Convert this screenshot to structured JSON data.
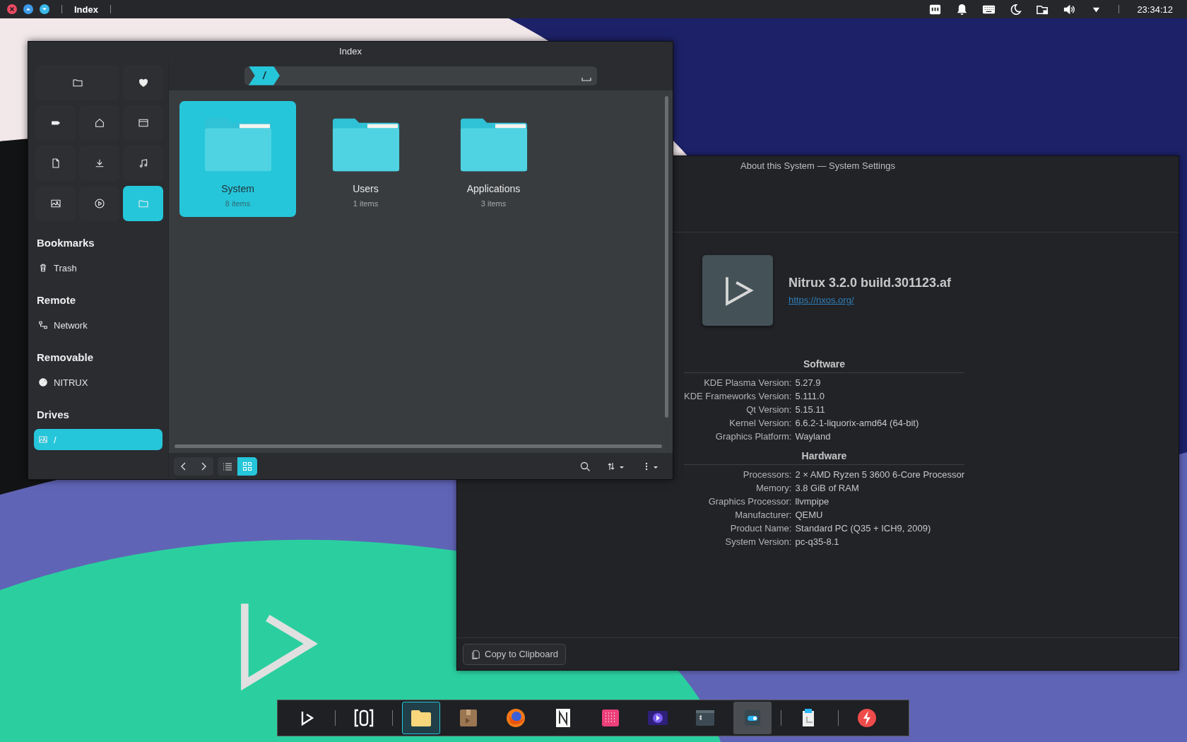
{
  "top_bar": {
    "window_title": "Index",
    "clock": "23:34:12"
  },
  "file_manager": {
    "title": "Index",
    "path": "/",
    "places": [
      {
        "selected": false
      },
      {
        "selected": false
      },
      {
        "selected": false
      },
      {
        "selected": false
      },
      {
        "selected": false
      },
      {
        "selected": false
      },
      {
        "selected": false
      },
      {
        "selected": false
      },
      {
        "selected": false
      },
      {
        "selected": false
      },
      {
        "selected": true
      }
    ],
    "sections": [
      {
        "title": "Bookmarks",
        "items": [
          {
            "label": "Trash",
            "selected": false
          }
        ]
      },
      {
        "title": "Remote",
        "items": [
          {
            "label": "Network",
            "selected": false
          }
        ]
      },
      {
        "title": "Removable",
        "items": [
          {
            "label": "NITRUX",
            "selected": false
          }
        ]
      },
      {
        "title": "Drives",
        "items": [
          {
            "label": "/",
            "selected": true
          }
        ]
      }
    ],
    "folders": [
      {
        "name": "System",
        "count": "8 items",
        "selected": true
      },
      {
        "name": "Users",
        "count": "1 items",
        "selected": false
      },
      {
        "name": "Applications",
        "count": "3 items",
        "selected": false
      }
    ],
    "view_buttons": [
      {
        "selected": false
      },
      {
        "selected": true
      }
    ]
  },
  "settings": {
    "title": "About this System — System Settings",
    "distro": "Nitrux 3.2.0 build.301123.af",
    "url": "https://nxos.org/",
    "sections": [
      {
        "title": "Software",
        "rows": [
          {
            "label": "KDE Plasma Version:",
            "value": "5.27.9"
          },
          {
            "label": "KDE Frameworks Version:",
            "value": "5.111.0"
          },
          {
            "label": "Qt Version:",
            "value": "5.15.11"
          },
          {
            "label": "Kernel Version:",
            "value": "6.6.2-1-liquorix-amd64 (64-bit)"
          },
          {
            "label": "Graphics Platform:",
            "value": "Wayland"
          }
        ]
      },
      {
        "title": "Hardware",
        "rows": [
          {
            "label": "Processors:",
            "value": "2 × AMD Ryzen 5 3600 6-Core Processor"
          },
          {
            "label": "Memory:",
            "value": "3.8 GiB of RAM"
          },
          {
            "label": "Graphics Processor:",
            "value": "llvmpipe"
          },
          {
            "label": "Manufacturer:",
            "value": "QEMU"
          },
          {
            "label": "Product Name:",
            "value": "Standard PC (Q35 + ICH9, 2009)"
          },
          {
            "label": "System Version:",
            "value": "pc-q35-8.1"
          }
        ]
      }
    ],
    "copy_button": "Copy to Clipboard"
  },
  "dock": {
    "items": [
      {
        "kind": "app",
        "focused": false,
        "open": false
      },
      {
        "kind": "separator"
      },
      {
        "kind": "app",
        "focused": false,
        "open": false
      },
      {
        "kind": "separator"
      },
      {
        "kind": "app",
        "focused": true,
        "open": false
      },
      {
        "kind": "app",
        "focused": false,
        "open": false
      },
      {
        "kind": "app",
        "focused": false,
        "open": false
      },
      {
        "kind": "app",
        "focused": false,
        "open": false
      },
      {
        "kind": "app",
        "focused": false,
        "open": false
      },
      {
        "kind": "app",
        "focused": false,
        "open": false
      },
      {
        "kind": "app",
        "focused": false,
        "open": false
      },
      {
        "kind": "app",
        "focused": false,
        "open": true
      },
      {
        "kind": "separator"
      },
      {
        "kind": "app",
        "focused": false,
        "open": false
      },
      {
        "kind": "separator"
      },
      {
        "kind": "app",
        "focused": false,
        "open": false
      }
    ]
  }
}
